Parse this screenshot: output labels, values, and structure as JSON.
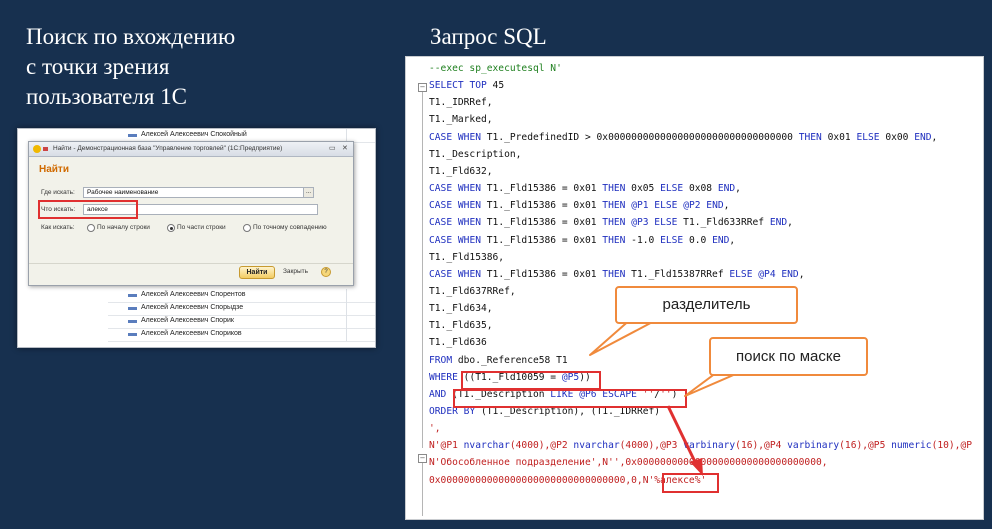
{
  "slide": {
    "left_heading_lines": [
      "Поиск по вхождению",
      "с точки зрения",
      "пользователя 1С"
    ],
    "right_heading": "Запрос SQL"
  },
  "onec": {
    "background_rows_top": [
      "Алексей Алексеевич Спокойный"
    ],
    "background_rows_bottom": [
      "Алексей Алексеевич Спорентов",
      "Алексей Алексеевич Спорыдзе",
      "Алексей Алексеевич Спорик",
      "Алексей Алексеевич Спориков"
    ],
    "dialog": {
      "title": "Найти - Демонстрационная база \"Управление торговлей\" (1С:Предприятие)",
      "heading": "Найти",
      "where_label": "Где искать:",
      "where_value": "Рабочее наименование",
      "what_label": "Что искать:",
      "what_value": "алексе",
      "how_label": "Как искать:",
      "options": [
        "По началу строки",
        "По части строки",
        "По точному совпадению"
      ],
      "selected_option": "По части строки",
      "find_button": "Найти",
      "close_link": "Закрыть",
      "help_icon_text": "?",
      "ellipsis": "..."
    }
  },
  "sql": {
    "lines": [
      "--exec sp_executesql N'",
      "SELECT TOP 45",
      "T1._IDRRef,",
      "T1._Marked,",
      "CASE WHEN T1._PredefinedID > 0x00000000000000000000000000000000 THEN 0x01 ELSE 0x00 END,",
      "T1._Description,",
      "T1._Fld632,",
      "CASE WHEN T1._Fld15386 = 0x01 THEN 0x05 ELSE 0x08 END,",
      "CASE WHEN T1._Fld15386 = 0x01 THEN @P1 ELSE @P2 END,",
      "CASE WHEN T1._Fld15386 = 0x01 THEN @P3 ELSE T1._Fld633RRef END,",
      "CASE WHEN T1._Fld15386 = 0x01 THEN -1.0 ELSE 0.0 END,",
      "T1._Fld15386,",
      "CASE WHEN T1._Fld15386 = 0x01 THEN T1._Fld15387RRef ELSE @P4 END,",
      "T1._Fld637RRef,",
      "T1._Fld634,",
      "T1._Fld635,",
      "T1._Fld636",
      "FROM dbo._Reference58 T1",
      "WHERE ((T1._Fld10059 = @P5))",
      "AND (T1._Description LIKE @P6 ESCAPE ''/'')",
      "ORDER BY (T1._Description), (T1._IDRRef)",
      "',",
      "N'@P1 nvarchar(4000),@P2 nvarchar(4000),@P3 varbinary(16),@P4 varbinary(16),@P5 numeric(10),@P",
      "N'Обособленное подразделение',N'',0x00000000000000000000000000000000,",
      "0x00000000000000000000000000000000,0,N'%алексе%'"
    ],
    "callout_separator": "разделитель",
    "callout_mask": "поиск по маске"
  }
}
